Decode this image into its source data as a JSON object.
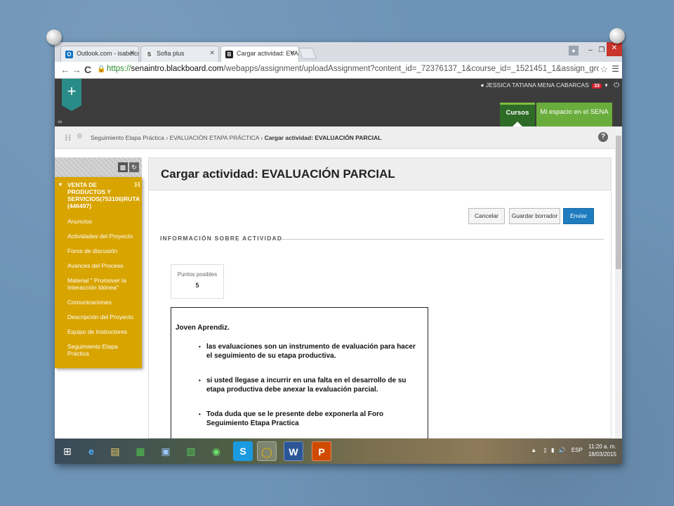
{
  "browser": {
    "tabs": [
      {
        "label": "Outlook.com - isabelcristi",
        "favicon": "outlook-icon",
        "color": "#0f72c6"
      },
      {
        "label": "Sofia plus",
        "favicon": "sofia-icon",
        "color": "#333333"
      },
      {
        "label": "Cargar actividad: EVALUAC",
        "favicon": "blackboard-icon",
        "color": "#222222"
      }
    ],
    "url_scheme": "https://",
    "url_host": "senaintro.blackboard.com",
    "url_path": "/webapps/assignment/uploadAssignment?content_id=_72376137_1&course_id=_1521451_1&assign_group_id=&mode=view"
  },
  "header": {
    "plus_label": "+",
    "user_name": "JESSICA TATIANA MENA CABARCAS",
    "notification_count": "33",
    "tab_cursos": "Cursos",
    "tab_sena": "Mi espacio en el SENA"
  },
  "breadcrumb": {
    "item1": "Seguimiento Etapa Práctica",
    "sep": " › ",
    "item2": "EVALUACIÓN ETAPA PRÁCTICA",
    "current": "Cargar actividad: EVALUACIÓN PARCIAL"
  },
  "sidebar": {
    "course_title": "VENTA DE PRODUCTOS Y SERVICIOS(753106)RUTA (446497)",
    "items": [
      "Anuncios",
      "Actividades del Proyecto",
      "Foros de discusión",
      "Avances del Proceso",
      "Material \" Promover la Interacción Idónea\"",
      "Comunicaciones",
      "Descripción del Proyecto",
      "Equipo de Instructores",
      "Seguimiento Etapa Práctica"
    ]
  },
  "main": {
    "title": "Cargar actividad: EVALUACIÓN PARCIAL",
    "cancel_label": "Cancelar",
    "draft_label": "Guardar borrador",
    "submit_label": "Enviar",
    "section_label": "INFORMACIÓN SOBRE ACTIVIDAD",
    "points_label": "Puntos posibles",
    "points_value": "5",
    "instructions": {
      "greeting": "Joven Aprendiz.",
      "bullets": [
        "las evaluaciones son un instrumento de evaluación para hacer el seguimiento de su etapa productiva.",
        "si usted llegase a incurrir en una falta en el desarrollo de su etapa productiva debe anexar la evaluación parcial.",
        "Toda duda que se le presente debe exponerla al Foro Seguimiento Etapa Practica"
      ]
    }
  },
  "taskbar": {
    "icons": [
      "windows-start-icon",
      "internet-explorer-icon",
      "file-explorer-icon",
      "store-icon",
      "network-icon",
      "spreadsheet-icon",
      "spotify-icon",
      "skype-icon",
      "chrome-icon",
      "word-icon",
      "powerpoint-icon"
    ],
    "language": "ESP",
    "time": "11:20 a. m.",
    "date": "18/03/2015"
  },
  "colors": {
    "sidebar": "#d8a400",
    "accent_teal": "#2a8c88",
    "cursos_green": "#2e6b26",
    "sena_green": "#6aad3c",
    "submit_blue": "#1f7cbf"
  }
}
